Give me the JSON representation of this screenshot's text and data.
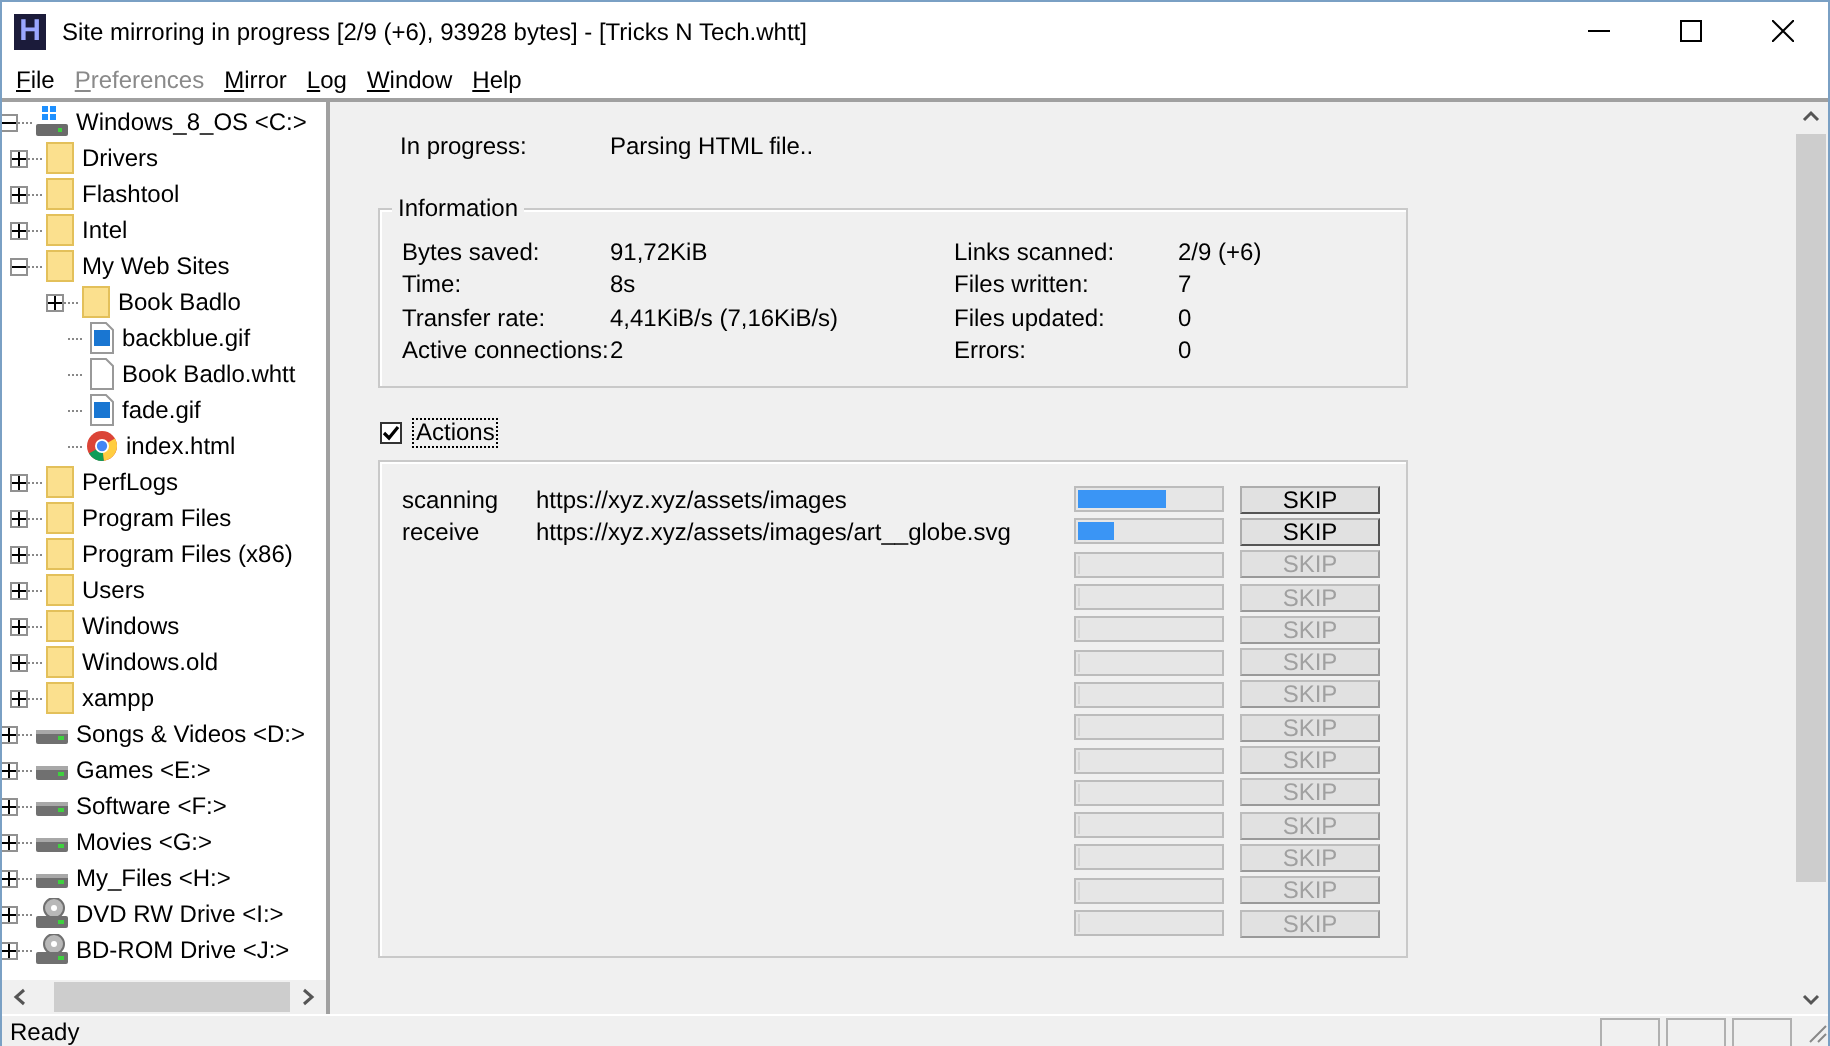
{
  "window": {
    "icon_letter": "H",
    "title": "Site mirroring in progress [2/9 (+6), 93928 bytes] - [Tricks N Tech.whtt]"
  },
  "menu": [
    {
      "label": "File",
      "disabled": false
    },
    {
      "label": "Preferences",
      "disabled": true
    },
    {
      "label": "Mirror",
      "disabled": false
    },
    {
      "label": "Log",
      "disabled": false
    },
    {
      "label": "Window",
      "disabled": false
    },
    {
      "label": "Help",
      "disabled": false
    }
  ],
  "tree": [
    {
      "label": "Windows_8_OS <C:>",
      "kind": "drive-windows",
      "expanded": true,
      "children": [
        {
          "label": "Drivers",
          "kind": "folder",
          "expanded": false
        },
        {
          "label": "Flashtool",
          "kind": "folder",
          "expanded": false
        },
        {
          "label": "Intel",
          "kind": "folder",
          "expanded": false
        },
        {
          "label": "My Web Sites",
          "kind": "folder",
          "expanded": true,
          "children": [
            {
              "label": "Book Badlo",
              "kind": "folder",
              "expanded": false
            },
            {
              "label": "backblue.gif",
              "kind": "image"
            },
            {
              "label": "Book Badlo.whtt",
              "kind": "file"
            },
            {
              "label": "fade.gif",
              "kind": "image"
            },
            {
              "label": "index.html",
              "kind": "browser"
            }
          ]
        },
        {
          "label": "PerfLogs",
          "kind": "folder",
          "expanded": false
        },
        {
          "label": "Program Files",
          "kind": "folder",
          "expanded": false
        },
        {
          "label": "Program Files (x86)",
          "kind": "folder",
          "expanded": false
        },
        {
          "label": "Users",
          "kind": "folder",
          "expanded": false
        },
        {
          "label": "Windows",
          "kind": "folder",
          "expanded": false
        },
        {
          "label": "Windows.old",
          "kind": "folder",
          "expanded": false
        },
        {
          "label": "xampp",
          "kind": "folder",
          "expanded": false
        }
      ]
    },
    {
      "label": "Songs & Videos <D:>",
      "kind": "drive",
      "expanded": false
    },
    {
      "label": "Games <E:>",
      "kind": "drive",
      "expanded": false
    },
    {
      "label": "Software <F:>",
      "kind": "drive",
      "expanded": false
    },
    {
      "label": "Movies <G:>",
      "kind": "drive",
      "expanded": false
    },
    {
      "label": "My_Files <H:>",
      "kind": "drive",
      "expanded": false
    },
    {
      "label": "DVD RW Drive <I:>",
      "kind": "dvd",
      "expanded": false
    },
    {
      "label": "BD-ROM Drive <J:>",
      "kind": "dvd",
      "expanded": false
    }
  ],
  "progress": {
    "label": "In progress:",
    "value": "Parsing HTML file.."
  },
  "information": {
    "title": "Information",
    "left": [
      {
        "label": "Bytes saved:",
        "value": "91,72KiB"
      },
      {
        "label": "Time:",
        "value": "8s"
      },
      {
        "label": "Transfer rate:",
        "value": "4,41KiB/s (7,16KiB/s)"
      },
      {
        "label": "Active connections:",
        "value": "2"
      }
    ],
    "right": [
      {
        "label": "Links scanned:",
        "value": "2/9 (+6)"
      },
      {
        "label": "Files written:",
        "value": "7"
      },
      {
        "label": "Files updated:",
        "value": "0"
      },
      {
        "label": "Errors:",
        "value": "0"
      }
    ]
  },
  "actions": {
    "label": "Actions",
    "checked": true,
    "rows": [
      {
        "status": "scanning",
        "url": "https://xyz.xyz/assets/images",
        "level": 0.62,
        "button": "SKIP",
        "disabled": false
      },
      {
        "status": "receive",
        "url": "https://xyz.xyz/assets/images/art__globe.svg",
        "level": 0.26,
        "button": "SKIP",
        "disabled": false
      },
      {
        "level": 0,
        "button": "SKIP",
        "disabled": true
      },
      {
        "level": 0,
        "button": "SKIP",
        "disabled": true
      },
      {
        "level": 0,
        "button": "SKIP",
        "disabled": true
      },
      {
        "level": 0,
        "button": "SKIP",
        "disabled": true
      },
      {
        "level": 0,
        "button": "SKIP",
        "disabled": true
      },
      {
        "level": 0,
        "button": "SKIP",
        "disabled": true
      },
      {
        "level": 0,
        "button": "SKIP",
        "disabled": true
      },
      {
        "level": 0,
        "button": "SKIP",
        "disabled": true
      },
      {
        "level": 0,
        "button": "SKIP",
        "disabled": true
      },
      {
        "level": 0,
        "button": "SKIP",
        "disabled": true
      },
      {
        "level": 0,
        "button": "SKIP",
        "disabled": true
      },
      {
        "level": 0,
        "button": "SKIP",
        "disabled": true
      }
    ]
  },
  "status_bar": {
    "text": "Ready"
  }
}
